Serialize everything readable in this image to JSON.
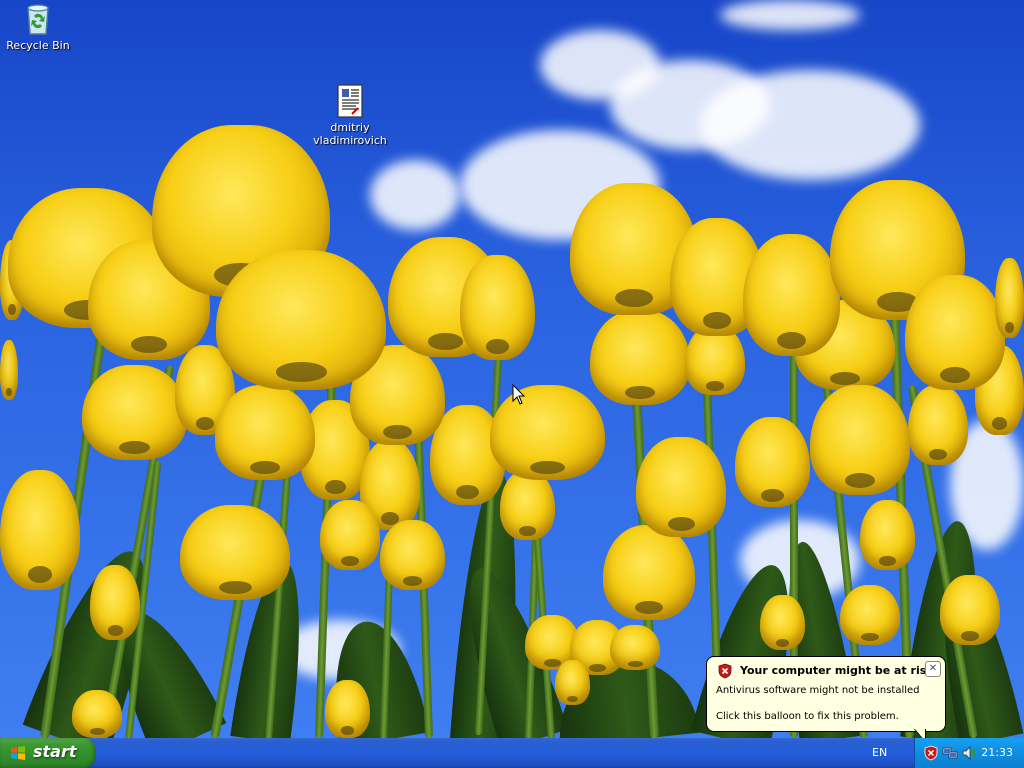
{
  "desktop": {
    "icons": [
      {
        "label": "Recycle Bin",
        "icon": "recycle-bin-icon"
      },
      {
        "label": "dmitriy\nvladimirovich",
        "icon": "document-icon"
      }
    ]
  },
  "taskbar": {
    "start_label": "start",
    "language": "EN",
    "clock": "21:33",
    "tray_icons": [
      "security-alert-shield-icon",
      "network-icon",
      "volume-icon"
    ]
  },
  "balloon": {
    "title": "Your computer might be at risk",
    "line1": "Antivirus software might not be installed",
    "line2": "Click this balloon to fix this problem.",
    "close_glyph": "✕",
    "icon": "security-shield-icon"
  },
  "colors": {
    "sky": "#2a63e0",
    "tulip": "#f7cf16",
    "taskbar": "#245edb",
    "start": "#3c9b33",
    "tray": "#0f8ee0",
    "balloon": "#ffffe1"
  }
}
